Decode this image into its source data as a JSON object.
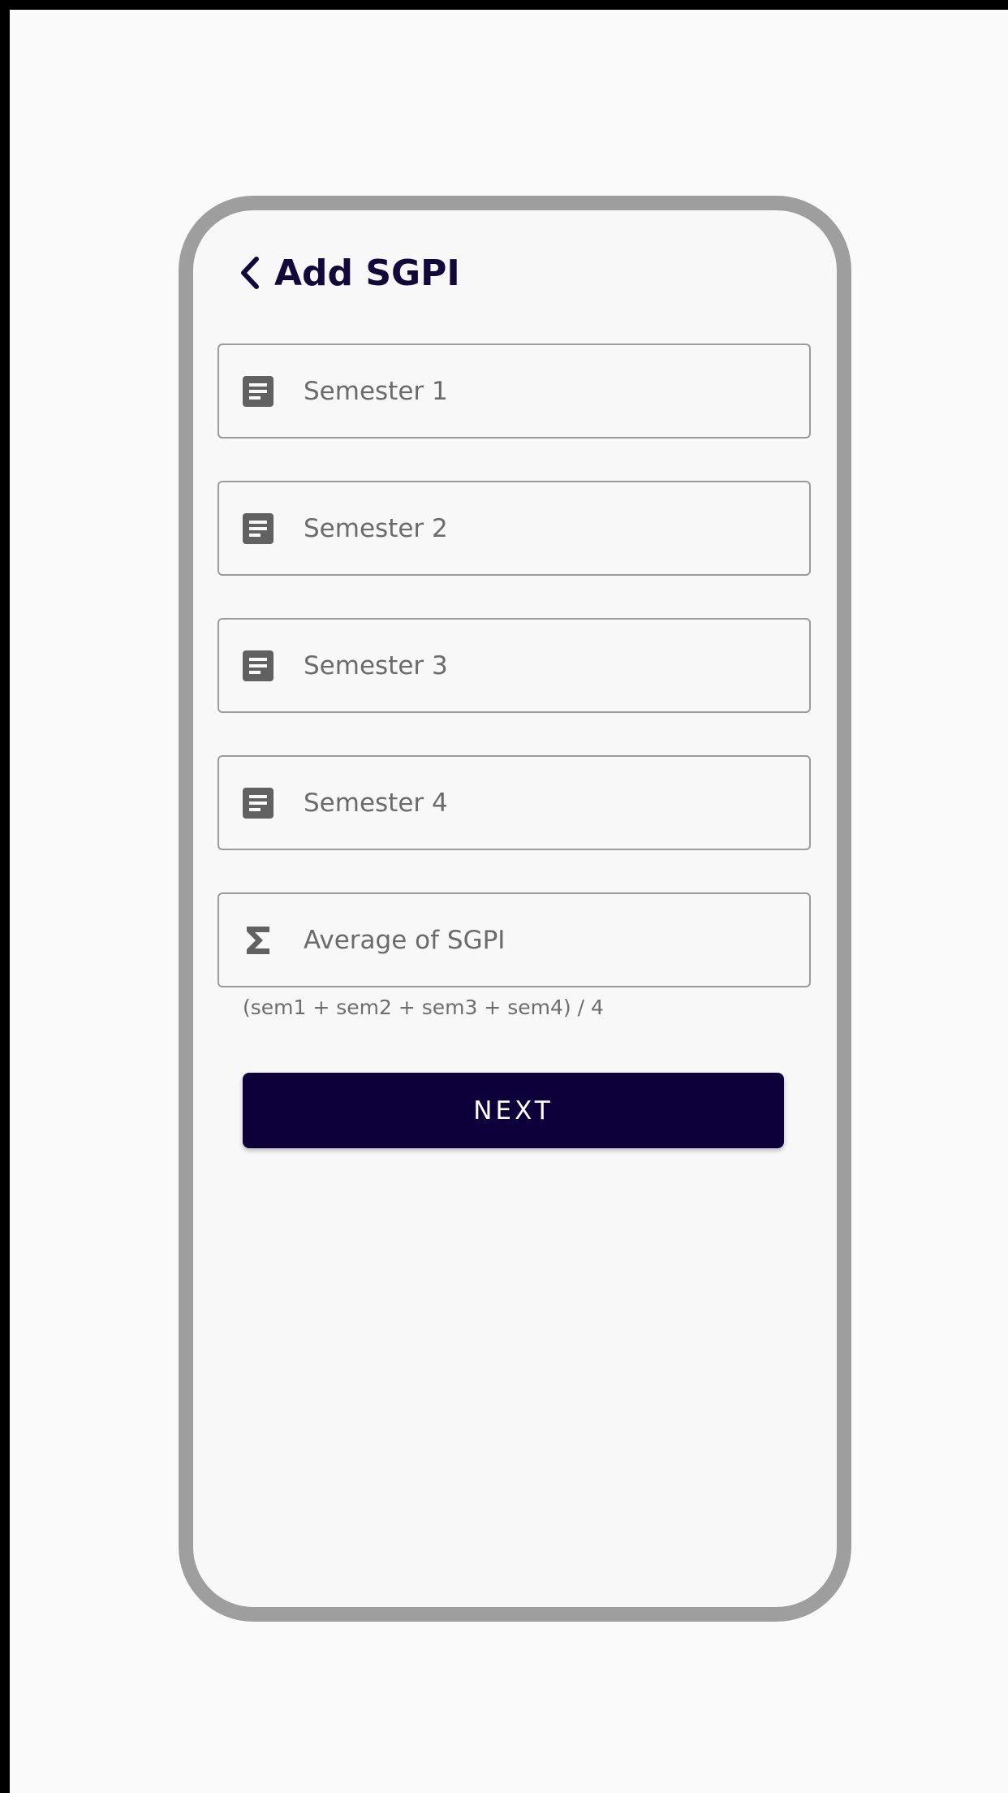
{
  "header": {
    "title": "Add SGPI",
    "back_icon": "chevron-left-icon"
  },
  "form": {
    "fields": [
      {
        "placeholder": "Semester 1",
        "value": "",
        "icon": "document-icon"
      },
      {
        "placeholder": "Semester 2",
        "value": "",
        "icon": "document-icon"
      },
      {
        "placeholder": "Semester 3",
        "value": "",
        "icon": "document-icon"
      },
      {
        "placeholder": "Semester 4",
        "value": "",
        "icon": "document-icon"
      },
      {
        "placeholder": "Average of SGPI",
        "value": "",
        "icon": "sigma-icon"
      }
    ],
    "average_helper": "(sem1 + sem2 + sem3 + sem4) / 4",
    "next_label": "NEXT"
  },
  "colors": {
    "accent": "#0d003a",
    "title": "#12083a",
    "frame": "#9e9e9e",
    "field_border": "#9b9b9b",
    "icon": "#616161"
  }
}
